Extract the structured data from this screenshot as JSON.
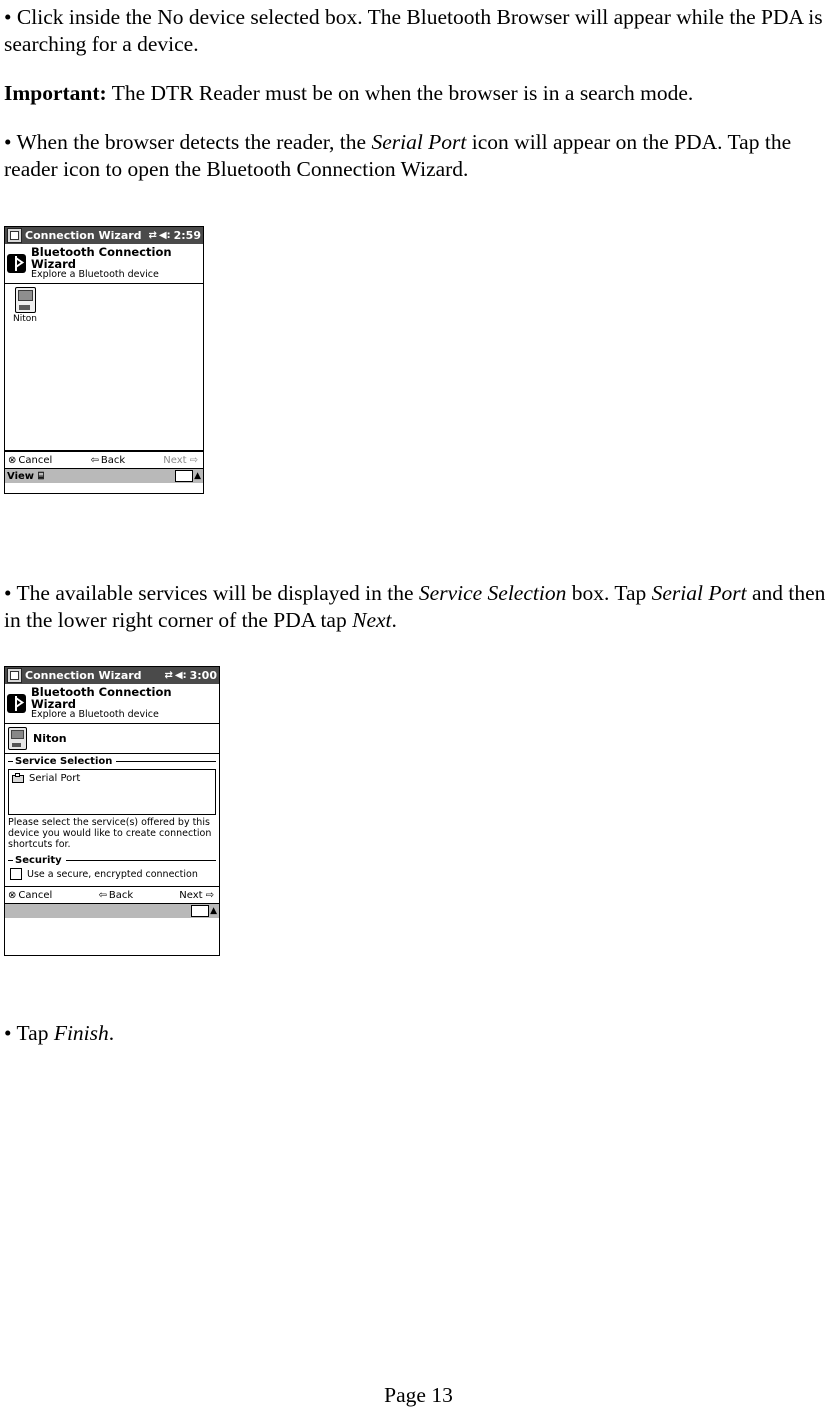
{
  "document": {
    "page_label": "Page 13",
    "paragraphs": [
      {
        "id": "p1",
        "runs": [
          {
            "text": "• Click inside the No device selected box. The Bluetooth Browser will appear while the PDA is searching for a device.",
            "style": "normal"
          }
        ]
      },
      {
        "id": "p2",
        "runs": [
          {
            "text": "Important:",
            "style": "bold"
          },
          {
            "text": " The DTR Reader must be on when the browser is in a search mode.",
            "style": "normal"
          }
        ]
      },
      {
        "id": "p3",
        "runs": [
          {
            "text": "• When the browser detects the reader, the ",
            "style": "normal"
          },
          {
            "text": "Serial Port",
            "style": "italic"
          },
          {
            "text": " icon will appear on the PDA. Tap the reader icon to open the Bluetooth Connection Wizard.",
            "style": "normal"
          }
        ]
      },
      {
        "id": "p4",
        "runs": [
          {
            "text": "• The available services will be displayed in the ",
            "style": "normal"
          },
          {
            "text": "Service Selection",
            "style": "italic"
          },
          {
            "text": " box. Tap ",
            "style": "normal"
          },
          {
            "text": "Serial Port",
            "style": "italic"
          },
          {
            "text": " and then in the lower right corner of the PDA tap ",
            "style": "normal"
          },
          {
            "text": "Next",
            "style": "italic"
          },
          {
            "text": ".",
            "style": "normal"
          }
        ]
      },
      {
        "id": "p5",
        "runs": [
          {
            "text": "• Tap ",
            "style": "normal"
          },
          {
            "text": "Finish",
            "style": "italic"
          },
          {
            "text": ".",
            "style": "normal"
          }
        ]
      }
    ]
  },
  "screenshot1": {
    "titlebar": {
      "app_icon": "pda-app-icon",
      "title": "Connection Wizard",
      "connect_icon": "bluetooth-connect-icon",
      "volume_icon": "speaker-icon",
      "time": "2:59"
    },
    "header": {
      "icon": "bluetooth-icon",
      "title": "Bluetooth Connection Wizard",
      "subtitle": "Explore a Bluetooth device"
    },
    "device_list": [
      {
        "icon": "pda-device-icon",
        "label": "Niton"
      }
    ],
    "commands": {
      "cancel": "Cancel",
      "cancel_icon": "cancel-circle-icon",
      "back": "Back",
      "back_icon": "back-arrow-icon",
      "next": "Next",
      "next_icon": "next-arrow-icon",
      "next_enabled": false
    },
    "taskbar": {
      "view_label": "View",
      "view_icon": "view-toggle-icon",
      "keyboard_icon": "keyboard-icon",
      "arrow_icon": "up-arrow-icon"
    }
  },
  "screenshot2": {
    "titlebar": {
      "app_icon": "pda-app-icon",
      "title": "Connection Wizard",
      "connect_icon": "bluetooth-connect-icon",
      "volume_icon": "speaker-icon",
      "time": "3:00"
    },
    "header": {
      "icon": "bluetooth-icon",
      "title": "Bluetooth Connection Wizard",
      "subtitle": "Explore a Bluetooth device"
    },
    "device": {
      "icon": "pda-device-icon",
      "name": "Niton"
    },
    "service_selection": {
      "group_label": "Service Selection",
      "items": [
        {
          "icon": "serial-port-icon",
          "label": "Serial Port"
        }
      ],
      "hint": "Please select the service(s) offered by this device you would like to create connection shortcuts for."
    },
    "security": {
      "group_label": "Security",
      "checkbox_label": "Use a secure, encrypted connection",
      "checked": false
    },
    "commands": {
      "cancel": "Cancel",
      "cancel_icon": "cancel-circle-icon",
      "back": "Back",
      "back_icon": "back-arrow-icon",
      "next": "Next",
      "next_icon": "next-arrow-icon",
      "next_enabled": true
    },
    "taskbar": {
      "keyboard_icon": "keyboard-icon",
      "arrow_icon": "up-arrow-icon"
    }
  }
}
